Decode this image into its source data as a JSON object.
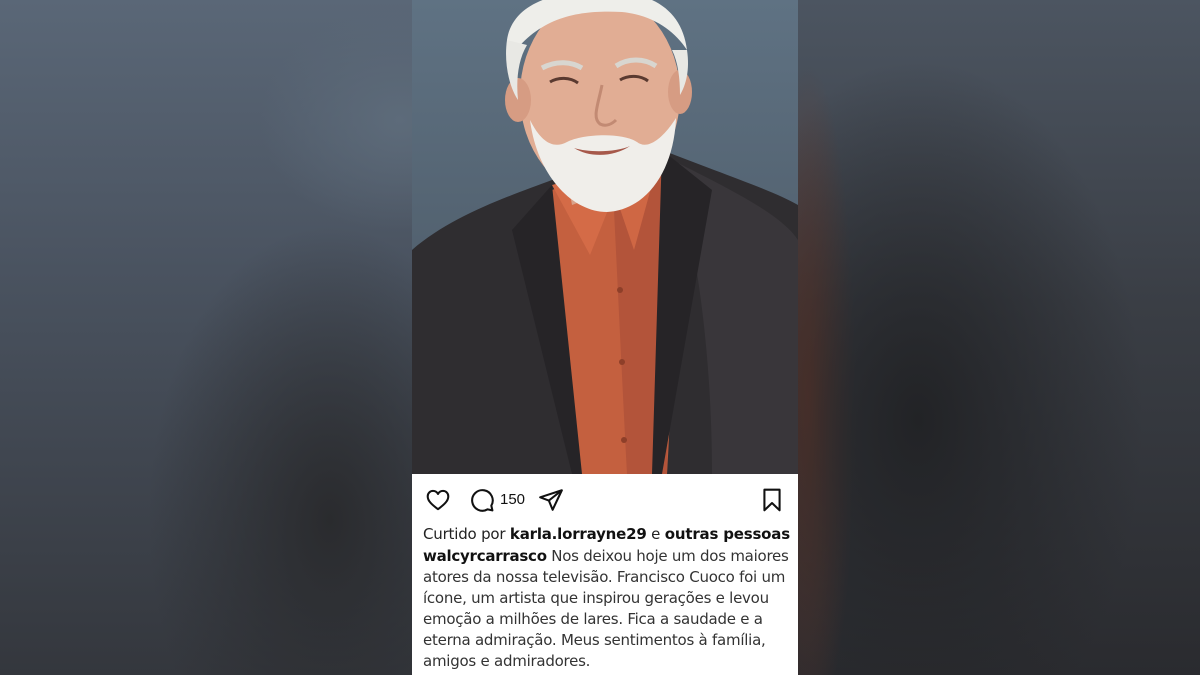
{
  "post": {
    "comment_count": "150",
    "liked_by": {
      "prefix": "Curtido por",
      "user": "karla.lorrayne29",
      "joiner": "e",
      "others": "outras pessoas"
    },
    "caption": {
      "username": "walcyrcarrasco",
      "text": "Nos deixou hoje um dos maiores atores da nossa televisão. Francisco Cuoco foi um ícone, um artista que inspirou gerações e levou emoção a milhões de lares. Fica a saudade e a eterna admiração. Meus sentimentos à família, amigos e admiradores."
    },
    "icons": {
      "like": "heart-icon",
      "comment": "comment-bubble-icon",
      "share": "paper-plane-icon",
      "save": "bookmark-icon"
    }
  },
  "colors": {
    "photo_background": "#5f7283",
    "shirt": "#c4603f",
    "jacket": "#2f2d30"
  }
}
